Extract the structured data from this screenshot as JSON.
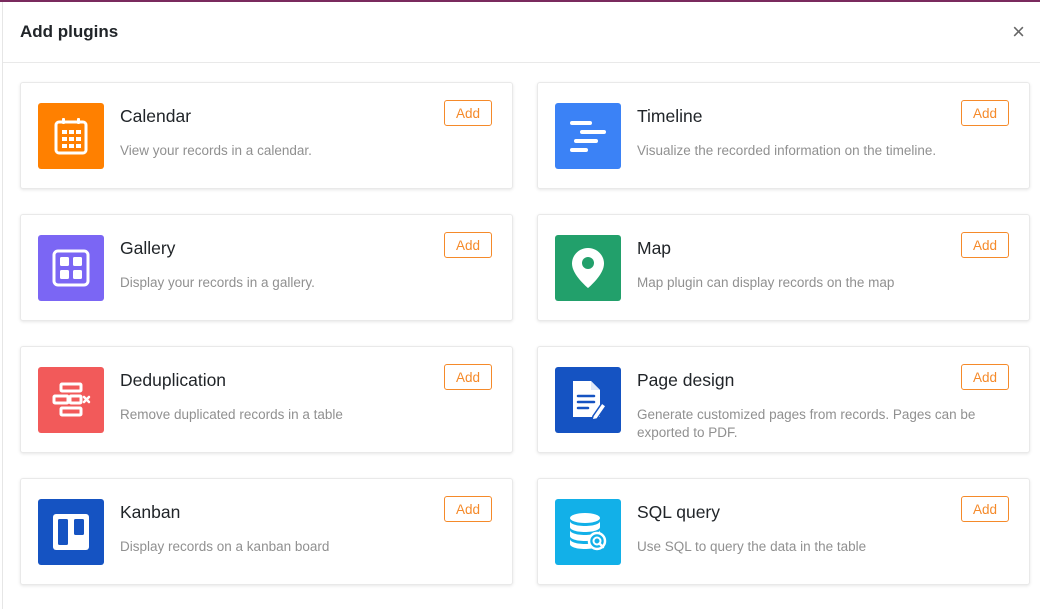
{
  "dialog": {
    "title": "Add plugins",
    "close_glyph": "×"
  },
  "plugins": [
    {
      "name": "Calendar",
      "description": "View your records in a calendar.",
      "add_label": "Add",
      "icon": "calendar-icon",
      "color": "#ff8000"
    },
    {
      "name": "Timeline",
      "description": "Visualize the recorded information on the timeline.",
      "add_label": "Add",
      "icon": "timeline-icon",
      "color": "#3b82f6"
    },
    {
      "name": "Gallery",
      "description": "Display your records in a gallery.",
      "add_label": "Add",
      "icon": "gallery-icon",
      "color": "#7b66f4"
    },
    {
      "name": "Map",
      "description": "Map plugin can display records on the map",
      "add_label": "Add",
      "icon": "map-pin-icon",
      "color": "#22a06b"
    },
    {
      "name": "Deduplication",
      "description": "Remove duplicated records in a table",
      "add_label": "Add",
      "icon": "deduplication-icon",
      "color": "#f25a5a"
    },
    {
      "name": "Page design",
      "description": "Generate customized pages from records. Pages can be exported to PDF.",
      "add_label": "Add",
      "icon": "page-design-icon",
      "color": "#1553c2"
    },
    {
      "name": "Kanban",
      "description": "Display records on a kanban board",
      "add_label": "Add",
      "icon": "kanban-icon",
      "color": "#1553c2"
    },
    {
      "name": "SQL query",
      "description": "Use SQL to query the data in the table",
      "add_label": "Add",
      "icon": "sql-query-icon",
      "color": "#12b0e8"
    }
  ],
  "accent_color": "#f58a2a"
}
